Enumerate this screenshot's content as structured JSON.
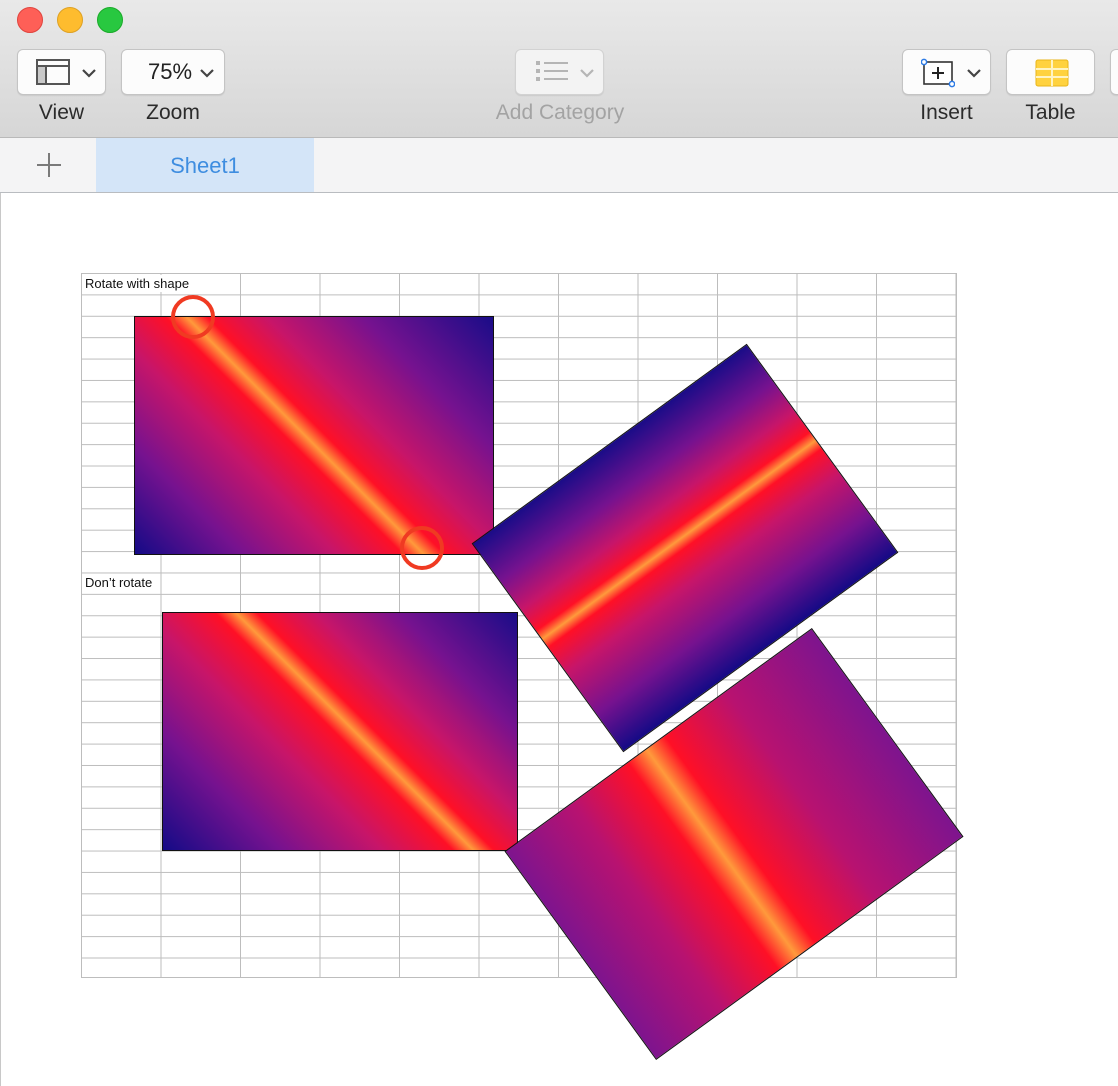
{
  "toolbar": {
    "view_label": "View",
    "zoom_label": "Zoom",
    "zoom_value": "75%",
    "add_category_label": "Add Category",
    "insert_label": "Insert",
    "table_label": "Table"
  },
  "tabs": {
    "sheet1_label": "Sheet1"
  },
  "sheet": {
    "label_rotate": "Rotate with shape",
    "label_dont_rotate": "Don’t rotate"
  },
  "colors": {
    "accent_tab": "#d4e5f8",
    "tab_text": "#3e8de0",
    "marker": "#f03a22",
    "gradient_dark": "#1a0c88",
    "gradient_red": "#ff1026",
    "gradient_orange": "#ff9a3c"
  },
  "icons": [
    "view-icon",
    "chevron-down-icon",
    "list-icon",
    "insert-icon",
    "table-icon",
    "plus-icon"
  ]
}
